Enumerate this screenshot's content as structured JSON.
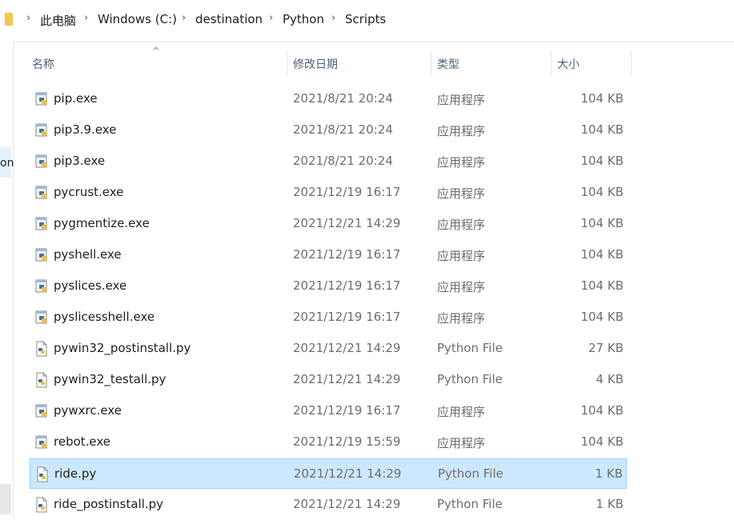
{
  "breadcrumb": [
    "此电脑",
    "Windows (C:)",
    "destination",
    "Python",
    "Scripts"
  ],
  "nav": {
    "partial_label": "on"
  },
  "columns": {
    "name": "名称",
    "date": "修改日期",
    "type": "类型",
    "size": "大小"
  },
  "files": [
    {
      "name": "pip.exe",
      "date": "2021/8/21 20:24",
      "type": "应用程序",
      "size": "104 KB",
      "icon": "exe-file-icon"
    },
    {
      "name": "pip3.9.exe",
      "date": "2021/8/21 20:24",
      "type": "应用程序",
      "size": "104 KB",
      "icon": "exe-file-icon"
    },
    {
      "name": "pip3.exe",
      "date": "2021/8/21 20:24",
      "type": "应用程序",
      "size": "104 KB",
      "icon": "exe-file-icon"
    },
    {
      "name": "pycrust.exe",
      "date": "2021/12/19 16:17",
      "type": "应用程序",
      "size": "104 KB",
      "icon": "exe-file-icon"
    },
    {
      "name": "pygmentize.exe",
      "date": "2021/12/21 14:29",
      "type": "应用程序",
      "size": "104 KB",
      "icon": "exe-file-icon"
    },
    {
      "name": "pyshell.exe",
      "date": "2021/12/19 16:17",
      "type": "应用程序",
      "size": "104 KB",
      "icon": "exe-file-icon"
    },
    {
      "name": "pyslices.exe",
      "date": "2021/12/19 16:17",
      "type": "应用程序",
      "size": "104 KB",
      "icon": "exe-file-icon"
    },
    {
      "name": "pyslicesshell.exe",
      "date": "2021/12/19 16:17",
      "type": "应用程序",
      "size": "104 KB",
      "icon": "exe-file-icon"
    },
    {
      "name": "pywin32_postinstall.py",
      "date": "2021/12/21 14:29",
      "type": "Python File",
      "size": "27 KB",
      "icon": "python-file-icon"
    },
    {
      "name": "pywin32_testall.py",
      "date": "2021/12/21 14:29",
      "type": "Python File",
      "size": "4 KB",
      "icon": "python-file-icon"
    },
    {
      "name": "pywxrc.exe",
      "date": "2021/12/19 16:17",
      "type": "应用程序",
      "size": "104 KB",
      "icon": "exe-file-icon"
    },
    {
      "name": "rebot.exe",
      "date": "2021/12/19 15:59",
      "type": "应用程序",
      "size": "104 KB",
      "icon": "exe-file-icon"
    },
    {
      "name": "ride.py",
      "date": "2021/12/21 14:29",
      "type": "Python File",
      "size": "1 KB",
      "icon": "python-file-icon",
      "selected": true
    },
    {
      "name": "ride_postinstall.py",
      "date": "2021/12/21 14:29",
      "type": "Python File",
      "size": "1 KB",
      "icon": "python-file-icon"
    }
  ],
  "colors": {
    "selection_bg": "#cce8ff",
    "selection_border": "#99d1ff",
    "header_text": "#4c607a"
  }
}
